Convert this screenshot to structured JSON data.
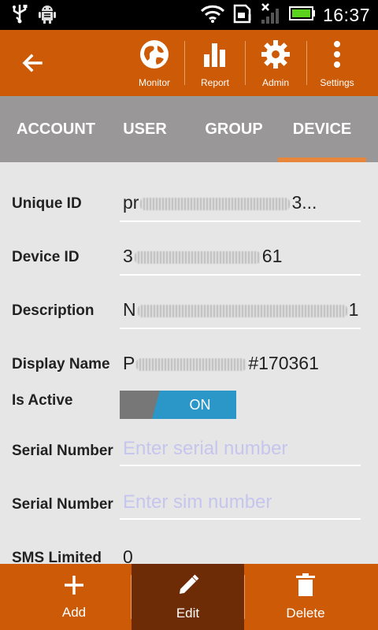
{
  "status_bar": {
    "time": "16:37"
  },
  "action_bar": {
    "actions": [
      {
        "label": "Monitor",
        "icon": "globe-icon"
      },
      {
        "label": "Report",
        "icon": "bar-chart-icon"
      },
      {
        "label": "Admin",
        "icon": "gear-icon"
      },
      {
        "label": "Settings",
        "icon": "overflow-menu-icon"
      }
    ]
  },
  "tabs": [
    {
      "label": "ACCOUNT"
    },
    {
      "label": "USER"
    },
    {
      "label": "GROUP"
    },
    {
      "label": "DEVICE",
      "active": true
    }
  ],
  "form": {
    "unique_id": {
      "label": "Unique ID",
      "value_start": "pr",
      "value_end": "3..."
    },
    "device_id": {
      "label": "Device ID",
      "value_start": "3",
      "value_end": "61"
    },
    "description": {
      "label": "Description",
      "value_start": "N",
      "value_end": "1"
    },
    "display_name": {
      "label": "Display Name",
      "value_start": "P",
      "value_end": "#170361"
    },
    "is_active": {
      "label": "Is Active",
      "toggle_text": "ON",
      "on": true
    },
    "serial_number": {
      "label": "Serial Number",
      "placeholder": "Enter serial number"
    },
    "sim_number": {
      "label": "Serial Number",
      "placeholder": "Enter sim number"
    },
    "sms_limited": {
      "label": "SMS Limited",
      "value": "0"
    }
  },
  "bottom_bar": {
    "actions": [
      {
        "label": "Add",
        "icon": "plus-icon"
      },
      {
        "label": "Edit",
        "icon": "pencil-icon",
        "active": true
      },
      {
        "label": "Delete",
        "icon": "trash-icon"
      }
    ]
  },
  "colors": {
    "brand_orange": "#cc5a06",
    "tab_bar_gray": "#999797",
    "tab_indicator": "#e8873c",
    "toggle_on_blue": "#2a97c8",
    "placeholder": "#c5c5ee"
  }
}
